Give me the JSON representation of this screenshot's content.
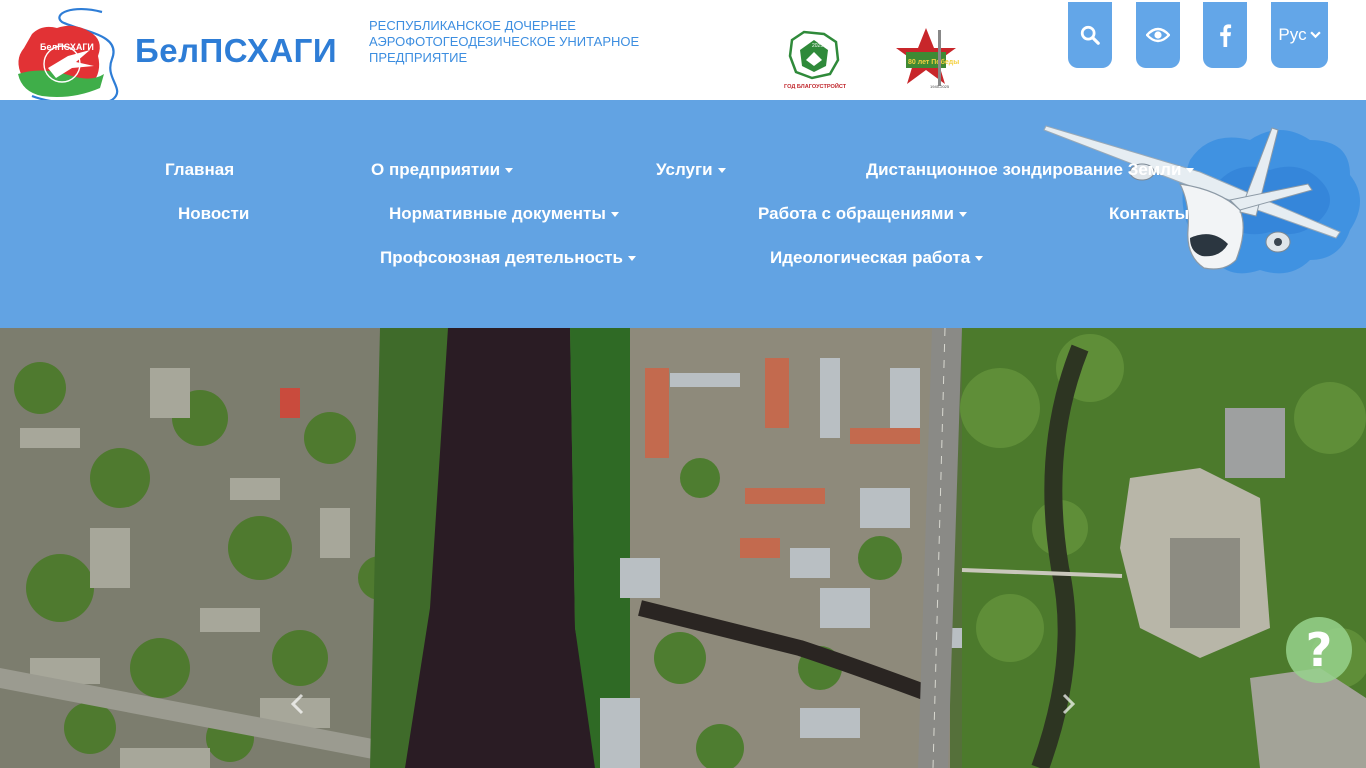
{
  "header": {
    "brand": "БелПСХАГИ",
    "tagline": [
      "РЕСПУБЛИКАНСКОЕ ДОЧЕРНЕЕ",
      "АЭРОФОТОГЕОДЕЗИЧЕСКОЕ УНИТАРНОЕ",
      "ПРЕДПРИЯТИЕ"
    ],
    "logo_text": "БелПСХАГИ",
    "emblem1_caption": "ГОД БЛАГОУСТРОЙСТВА",
    "emblem1_year": "2025",
    "emblem2_label": "80 лет Победы",
    "emblem2_years": "1945-2025"
  },
  "toolbar": {
    "search_icon": "search-icon",
    "accessibility_icon": "eye-icon",
    "facebook_icon": "facebook-icon",
    "lang_label": "Рус"
  },
  "nav": {
    "items": [
      {
        "label": "Главная"
      },
      {
        "label": "О предприятии"
      },
      {
        "label": "Услуги"
      },
      {
        "label": "Дистанционное зондирование Земли"
      },
      {
        "label": "Новости"
      },
      {
        "label": "Нормативные документы"
      },
      {
        "label": "Работа с обращениями"
      },
      {
        "label": "Контакты"
      },
      {
        "label": "Профсоюзная деятельность"
      },
      {
        "label": "Идеологическая работа"
      }
    ]
  },
  "hero": {
    "prev_icon": "chevron-left-icon",
    "next_icon": "chevron-right-icon",
    "help_label": "?"
  },
  "colors": {
    "nav_bg": "#62a3e3",
    "button_bg": "#63a6e8",
    "brand": "#2e7dd6",
    "river": "#2a1c24"
  }
}
